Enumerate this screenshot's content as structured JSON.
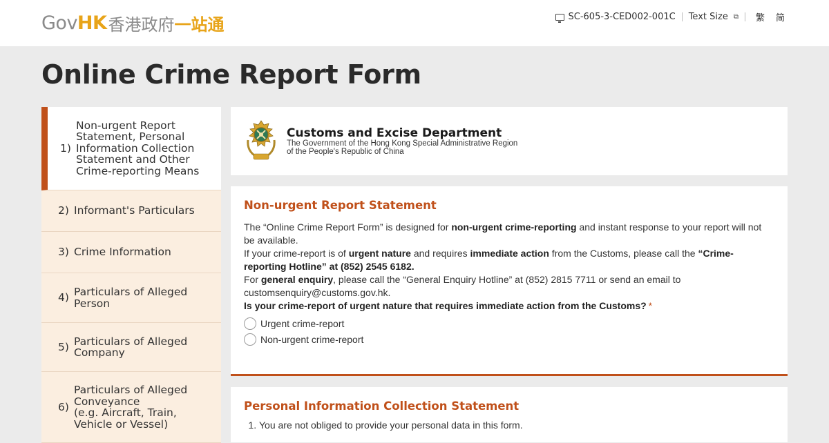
{
  "header": {
    "logo": {
      "gov": "Gov",
      "hk": "HK",
      "cn_a": "香港政府",
      "cn_b": "一站通"
    },
    "form_code": "SC-605-3-CED002-001C",
    "text_size": "Text Size",
    "lang_tc": "繁",
    "lang_sc": "简"
  },
  "page_title": "Online Crime Report Form",
  "sidebar": {
    "items": [
      {
        "num": "1)",
        "label": "Non-urgent Report\nStatement, Personal\nInformation Collection\nStatement and Other\nCrime-reporting Means",
        "active": true
      },
      {
        "num": "2)",
        "label": "Informant's Particulars",
        "active": false
      },
      {
        "num": "3)",
        "label": "Crime Information",
        "active": false
      },
      {
        "num": "4)",
        "label": "Particulars of Alleged\nPerson",
        "active": false
      },
      {
        "num": "5)",
        "label": "Particulars of Alleged\nCompany",
        "active": false
      },
      {
        "num": "6)",
        "label": "Particulars of Alleged\nConveyance\n(e.g. Aircraft, Train,\nVehicle or Vessel)",
        "active": false
      }
    ]
  },
  "department": {
    "name": "Customs and Excise Department",
    "sub1": "The Government of the Hong Kong Special Administrative Region",
    "sub2": "of the People's Republic of China"
  },
  "statement": {
    "title": "Non-urgent Report Statement",
    "p1_a": "The “Online Crime Report Form” is designed for ",
    "p1_b": "non-urgent crime-reporting",
    "p1_c": " and instant response to your report will not be available.",
    "p2_a": "If your crime-report is of ",
    "p2_b": "urgent nature",
    "p2_c": " and requires ",
    "p2_d": "immediate action",
    "p2_e": " from the Customs, please call the ",
    "p2_f": "“Crime-reporting Hotline” at (852) 2545 6182.",
    "p3_a": "For ",
    "p3_b": "general enquiry",
    "p3_c": ", please call the “General Enquiry Hotline” at (852) 2815 7711 or send an email to customsenquiry@customs.gov.hk.",
    "question": "Is your crime-report of urgent nature that requires immediate action from the Customs?",
    "required_mark": "*",
    "options": [
      "Urgent crime-report",
      "Non-urgent crime-report"
    ]
  },
  "pics": {
    "title": "Personal Information Collection Statement",
    "items": [
      "You are not obliged to provide your personal data in this form."
    ]
  },
  "colors": {
    "accent": "#c0501a",
    "gold": "#e8a419",
    "sidebar_bg": "#fbeee0",
    "page_bg": "#ebebeb"
  }
}
